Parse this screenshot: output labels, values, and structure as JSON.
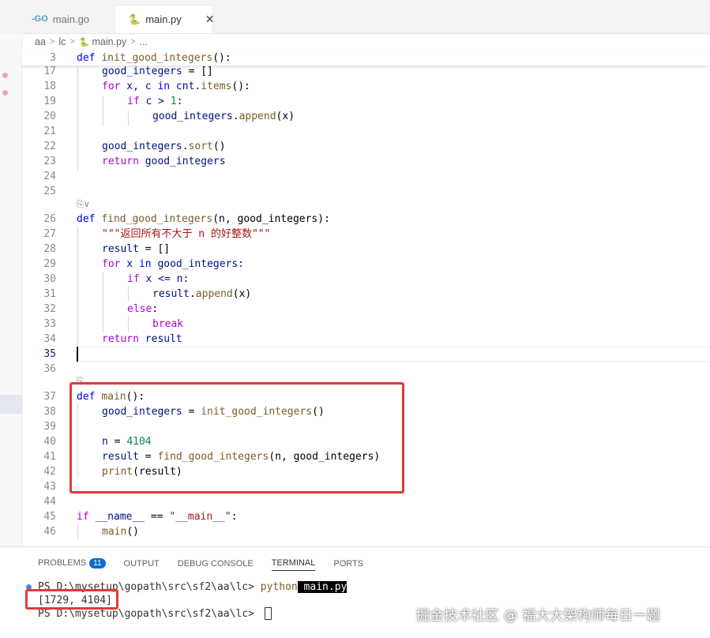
{
  "tabs": [
    {
      "label": "main.go",
      "icon": "go-file-icon",
      "active": false
    },
    {
      "label": "main.py",
      "icon": "python-file-icon",
      "active": true,
      "close": "✕"
    }
  ],
  "breadcrumb": [
    "aa",
    "lc",
    "main.py",
    "..."
  ],
  "code_lines": [
    {
      "num": "3"
    },
    {
      "num": "17"
    },
    {
      "num": "18"
    },
    {
      "num": "19"
    },
    {
      "num": "20"
    },
    {
      "num": "21"
    },
    {
      "num": "22"
    },
    {
      "num": "23"
    },
    {
      "num": "24"
    },
    {
      "num": "25"
    },
    {
      "num": "26"
    },
    {
      "num": "27"
    },
    {
      "num": "28"
    },
    {
      "num": "29"
    },
    {
      "num": "30"
    },
    {
      "num": "31"
    },
    {
      "num": "32"
    },
    {
      "num": "33"
    },
    {
      "num": "34"
    },
    {
      "num": "35"
    },
    {
      "num": "36"
    },
    {
      "num": "37"
    },
    {
      "num": "38"
    },
    {
      "num": "39"
    },
    {
      "num": "40"
    },
    {
      "num": "41"
    },
    {
      "num": "42"
    },
    {
      "num": "43"
    },
    {
      "num": "44"
    },
    {
      "num": "45"
    },
    {
      "num": "46"
    }
  ],
  "code": {
    "l3_kw": "def",
    "l3_fn": "init_good_integers",
    "l3_rest": "():",
    "l17_var": "good_integers",
    "l17_rest": " = []",
    "l18_kw": "for",
    "l18_a": " x, c ",
    "l18_in": "in",
    "l18_b": " cnt.",
    "l18_fn": "items",
    "l18_c": "():",
    "l19_kw": "if",
    "l19_a": " c > ",
    "l19_num": "1",
    "l19_b": ":",
    "l20_var": "good_integers",
    "l20_a": ".",
    "l20_fn": "append",
    "l20_b": "(x)",
    "l22_var": "good_integers",
    "l22_a": ".",
    "l22_fn": "sort",
    "l22_b": "()",
    "l23_kw": "return",
    "l23_var": " good_integers",
    "l26_kw": "def",
    "l26_fn": "find_good_integers",
    "l26_rest": "(n, good_integers):",
    "l27_str": "\"\"\"返回所有不大于 n 的好整数\"\"\"",
    "l28_var": "result",
    "l28_rest": " = []",
    "l29_kw": "for",
    "l29_a": " x ",
    "l29_in": "in",
    "l29_b": " good_integers:",
    "l30_kw": "if",
    "l30_rest": " x <= n:",
    "l31_var": "result",
    "l31_a": ".",
    "l31_fn": "append",
    "l31_b": "(x)",
    "l32_kw": "else",
    "l32_rest": ":",
    "l33_kw": "break",
    "l34_kw": "return",
    "l34_var": " result",
    "l37_kw": "def",
    "l37_fn": "main",
    "l37_rest": "():",
    "l38_var": "good_integers",
    "l38_a": " = ",
    "l38_fn": "init_good_integers",
    "l38_b": "()",
    "l40_var": "n",
    "l40_a": " = ",
    "l40_num": "4104",
    "l41_var": "result",
    "l41_a": " = ",
    "l41_fn": "find_good_integers",
    "l41_b": "(n, good_integers)",
    "l42_fn": "print",
    "l42_rest": "(result)",
    "l45_kw": "if",
    "l45_var": " __name__",
    "l45_a": " == ",
    "l45_str": "\"__main__\"",
    "l45_b": ":",
    "l46_fn": "main",
    "l46_rest": "()"
  },
  "panel": {
    "tabs": [
      {
        "label": "PROBLEMS",
        "badge": "11"
      },
      {
        "label": "OUTPUT"
      },
      {
        "label": "DEBUG CONSOLE"
      },
      {
        "label": "TERMINAL",
        "active": true
      },
      {
        "label": "PORTS"
      }
    ]
  },
  "terminal": {
    "prompt1": "PS D:\\mysetup\\gopath\\src\\sf2\\aa\\lc> ",
    "cmd": "python",
    "arg": " main.py",
    "output": "[1729, 4104]",
    "prompt2": "PS D:\\mysetup\\gopath\\src\\sf2\\aa\\lc> "
  },
  "watermark": "掘金技术社区 @ 福大大架构师每日一题",
  "colors": {
    "keyword": "#0000ff",
    "control": "#af00db",
    "function": "#795e26",
    "variable": "#001080",
    "number": "#098658",
    "string": "#a31515",
    "highlight_box": "#e03b3b"
  }
}
